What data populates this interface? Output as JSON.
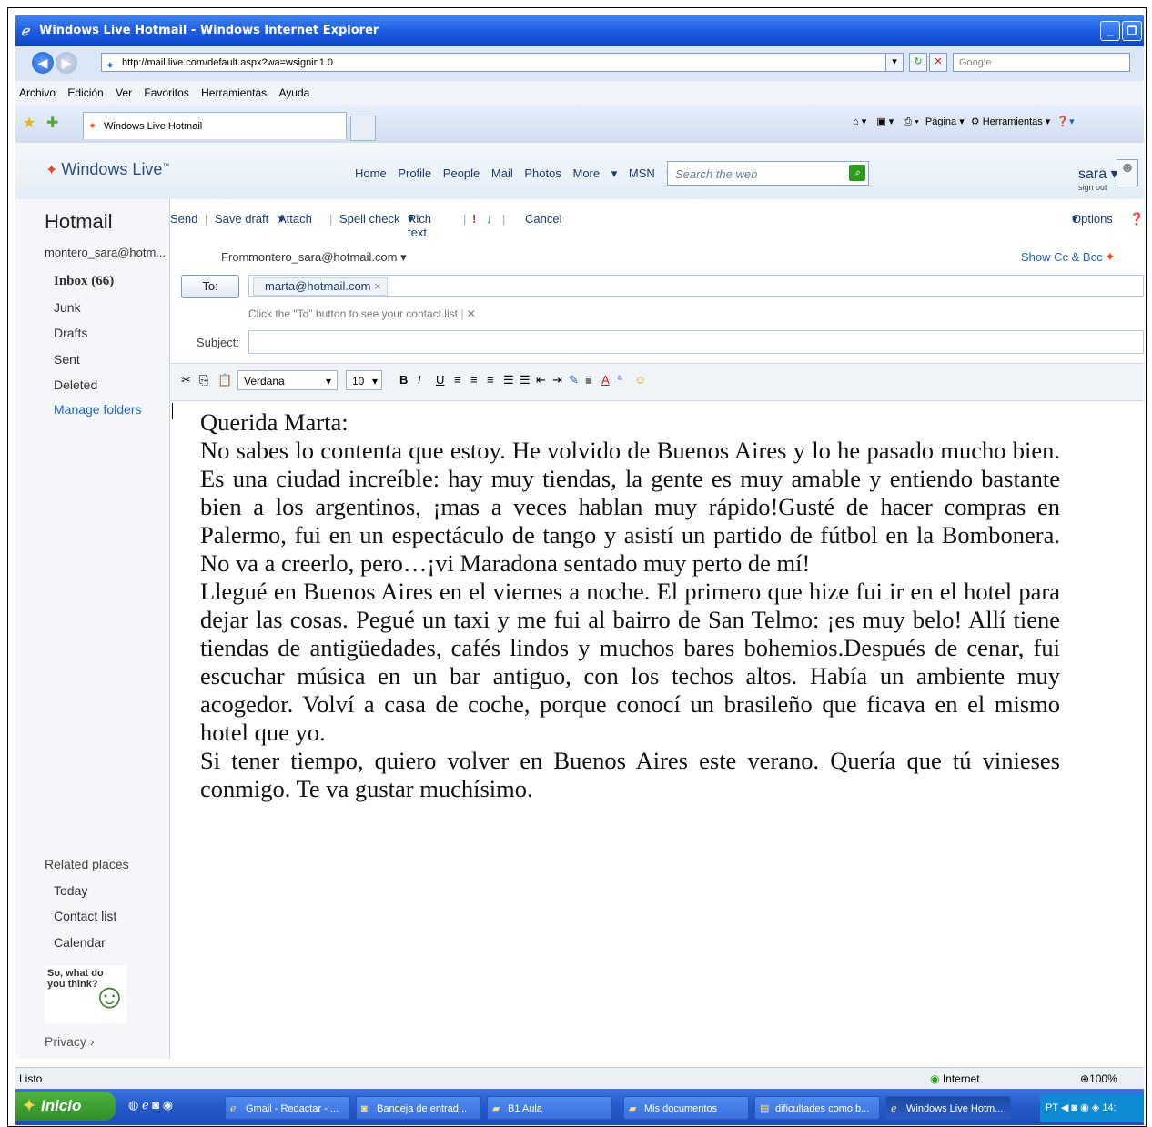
{
  "window": {
    "title": "Windows Live Hotmail - Windows Internet Explorer"
  },
  "address": {
    "url": "http://mail.live.com/default.aspx?wa=wsignin1.0",
    "search_placeholder": "Google"
  },
  "menu": [
    "Archivo",
    "Edición",
    "Ver",
    "Favoritos",
    "Herramientas",
    "Ayuda"
  ],
  "tab": {
    "label": "Windows Live Hotmail"
  },
  "commands": {
    "page": "Página",
    "tools": "Herramientas"
  },
  "live": {
    "logo": "Windows Live",
    "nav": [
      "Home",
      "Profile",
      "People",
      "Mail",
      "Photos",
      "More",
      "MSN"
    ],
    "search_placeholder": "Search the web",
    "user": "sara",
    "signout": "sign out"
  },
  "sidebar": {
    "title": "Hotmail",
    "account": "montero_sara@hotm...",
    "folders": [
      "Inbox (66)",
      "Junk",
      "Drafts",
      "Sent",
      "Deleted",
      "Manage folders"
    ],
    "related_title": "Related places",
    "related": [
      "Today",
      "Contact list",
      "Calendar"
    ],
    "feedback": "So, what do you think?",
    "privacy": "Privacy"
  },
  "toolbar": {
    "send": "Send",
    "save_draft": "Save draft",
    "attach": "Attach",
    "spell": "Spell check",
    "rich": "Rich text",
    "cancel": "Cancel",
    "options": "Options"
  },
  "compose": {
    "from_label": "From:",
    "from_value": "montero_sara@hotmail.com",
    "show_cc": "Show Cc & Bcc",
    "to_button": "To:",
    "to_value": "marta@hotmail.com",
    "to_hint": "Click the \"To\" button to see your contact list",
    "subject_label": "Subject:",
    "font": "Verdana",
    "size": "10"
  },
  "body": {
    "greeting": "Querida Marta:",
    "p1": "No sabes lo contenta que estoy. He volvido de Buenos Aires y lo he pasado mucho bien. Es una ciudad increíble: hay muy tiendas, la gente es muy amable y entiendo bastante bien a los argentinos, ¡mas a veces hablan muy rápido!Gusté de hacer compras en Palermo, fui en un espectáculo de tango y asistí un partido de fútbol en la Bombonera. No va a creerlo, pero…¡vi Maradona sentado muy perto de mí!",
    "p2": "Llegué en Buenos Aires en el viernes a noche. El primero que hize fui ir en el hotel para dejar las cosas. Pegué un taxi y me fui al bairro de San Telmo: ¡es muy belo! Allí tiene tiendas de antigüedades, cafés lindos y muchos bares bohemios.Después de cenar, fui escuchar música en un bar antiguo, con los techos altos. Había un ambiente muy acogedor. Volví a casa de coche, porque conocí un brasileño que ficava en el mismo hotel que yo.",
    "p3": "Si tener tiempo, quiero volver en Buenos Aires este verano. Quería que tú vinieses conmigo. Te va gustar muchísimo."
  },
  "status": {
    "left": "Listo",
    "zone": "Internet",
    "zoom": "100%"
  },
  "taskbar": {
    "start": "Inicio",
    "tasks": [
      "Gmail - Redactar - ...",
      "Bandeja de entrad...",
      "B1 Aula",
      "Mis documentos",
      "dificultades como b...",
      "Windows Live Hotm..."
    ],
    "tray": "PT",
    "clock": "14:"
  }
}
